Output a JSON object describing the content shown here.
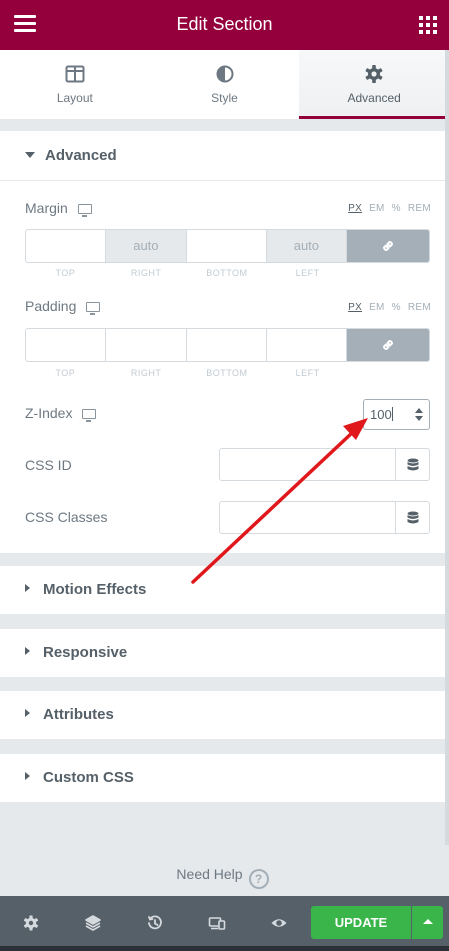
{
  "header": {
    "title": "Edit Section"
  },
  "tabs": [
    {
      "label": "Layout",
      "icon": "columns-icon"
    },
    {
      "label": "Style",
      "icon": "half-circle-icon"
    },
    {
      "label": "Advanced",
      "icon": "gear-icon",
      "active": true
    }
  ],
  "advanced": {
    "title": "Advanced",
    "margin": {
      "label": "Margin",
      "units": [
        "PX",
        "EM",
        "%",
        "REM"
      ],
      "selected_unit": "PX",
      "values": {
        "top": "",
        "right": "auto",
        "bottom": "",
        "left": "auto"
      },
      "labels": {
        "top": "TOP",
        "right": "RIGHT",
        "bottom": "BOTTOM",
        "left": "LEFT"
      }
    },
    "padding": {
      "label": "Padding",
      "units": [
        "PX",
        "EM",
        "%",
        "REM"
      ],
      "selected_unit": "PX",
      "values": {
        "top": "",
        "right": "",
        "bottom": "",
        "left": ""
      },
      "labels": {
        "top": "TOP",
        "right": "RIGHT",
        "bottom": "BOTTOM",
        "left": "LEFT"
      }
    },
    "zindex": {
      "label": "Z-Index",
      "value": "100"
    },
    "css_id": {
      "label": "CSS ID",
      "value": ""
    },
    "css_classes": {
      "label": "CSS Classes",
      "value": ""
    }
  },
  "sections": {
    "motion": "Motion Effects",
    "responsive": "Responsive",
    "attributes": "Attributes",
    "custom_css": "Custom CSS"
  },
  "help": {
    "label": "Need Help"
  },
  "footer": {
    "update_label": "UPDATE"
  },
  "colors": {
    "brand": "#93003c",
    "update": "#39b54a",
    "footer": "#556068",
    "annotation_arrow": "#e0181c"
  }
}
